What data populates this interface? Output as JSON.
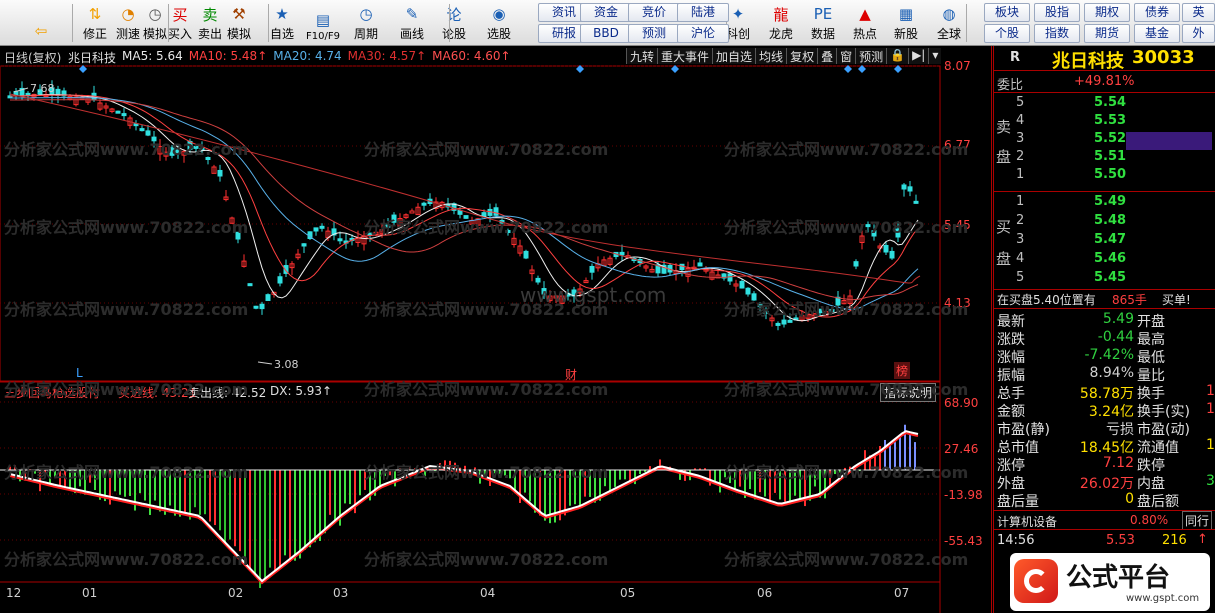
{
  "toolbar": {
    "buttons": [
      {
        "label": "",
        "icon": "back-arrow-icon",
        "color": "#f2a000"
      },
      {
        "label": "修正",
        "icon": "up-down-arrow-icon",
        "color": "#f2a000"
      },
      {
        "label": "测速",
        "icon": "speed-icon",
        "color": "#e08000"
      },
      {
        "label": "模拟",
        "icon": "clock-icon",
        "color": "#555"
      },
      {
        "label": "买入",
        "icon": "buy-icon",
        "color": "#d00"
      },
      {
        "label": "卖出",
        "icon": "sell-icon",
        "color": "#080"
      },
      {
        "label": "模拟",
        "icon": "hammer-icon",
        "color": "#a04000"
      },
      {
        "label": "自选",
        "icon": "star-icon",
        "color": "#1a5fb4"
      },
      {
        "label": "F10/F9",
        "icon": "f10-icon",
        "color": "#1a5fb4"
      },
      {
        "label": "周期",
        "icon": "period-icon",
        "color": "#1a5fb4"
      },
      {
        "label": "画线",
        "icon": "pencil-icon",
        "color": "#1a5fb4"
      },
      {
        "label": "论股",
        "icon": "forum-icon",
        "color": "#1a5fb4"
      },
      {
        "label": "选股",
        "icon": "select-stock-icon",
        "color": "#1a5fb4"
      },
      {
        "label": "科创",
        "icon": "star-market-icon",
        "color": "#1a5fb4"
      },
      {
        "label": "龙虎",
        "icon": "dragon-tiger-icon",
        "color": "#d00"
      },
      {
        "label": "数据",
        "icon": "pe-data-icon",
        "color": "#1a5fb4"
      },
      {
        "label": "热点",
        "icon": "hot-icon",
        "color": "#d00"
      },
      {
        "label": "新股",
        "icon": "ipo-icon",
        "color": "#1a5fb4"
      },
      {
        "label": "全球",
        "icon": "globe-icon",
        "color": "#1a5fb4"
      }
    ],
    "small_buttons": [
      [
        "资讯",
        "研报"
      ],
      [
        "资金",
        "BBD"
      ],
      [
        "竞价",
        "预测"
      ],
      [
        "陆港",
        "沪伦"
      ],
      [
        "板块",
        "个股"
      ],
      [
        "股指",
        "指数"
      ],
      [
        "期权",
        "期货"
      ],
      [
        "债券",
        "基金"
      ],
      [
        "英",
        "外"
      ]
    ]
  },
  "chart": {
    "title": "日线(复权)",
    "stock_name": "兆日科技",
    "ma": [
      {
        "label": "MA5: 5.64",
        "color": "#e8e8e8"
      },
      {
        "label": "MA10: 5.48↑",
        "color": "#ff4040"
      },
      {
        "label": "MA20: 4.74",
        "color": "#58b0e8"
      },
      {
        "label": "MA30: 4.57↑",
        "color": "#e03030"
      },
      {
        "label": "MA60: 4.60↑",
        "color": "#ff5050"
      }
    ],
    "top_buttons": [
      "九转",
      "重大事件",
      "加自选",
      "均线",
      "复权",
      "叠",
      "窗",
      "预测",
      "🔒",
      "▶|",
      "▾"
    ],
    "price_axis": [
      "8.07",
      "6.77",
      "5.45",
      "4.13"
    ],
    "high_label": "7.68",
    "low_label": "3.08",
    "markers": [
      "L",
      "财",
      "榜"
    ],
    "indicator": {
      "name": "三步回马枪选股付",
      "buy_line": "买进线: 43.21",
      "sell_line": "卖出线: 42.52",
      "dx": "DX: 5.93↑",
      "explain_button": "指标说明",
      "axis": [
        "68.90",
        "27.46",
        "-13.98",
        "-55.43"
      ]
    },
    "date_axis": [
      "12",
      "01",
      "02",
      "03",
      "04",
      "05",
      "06",
      "07"
    ],
    "watermark_site": "分析家公式网www.70822.com",
    "watermark_gspt": "www.gspt.com"
  },
  "panel": {
    "header": {
      "label": "R",
      "name": "兆日科技",
      "code": "30033"
    },
    "weibi": {
      "label": "委比",
      "value": "+49.81%"
    },
    "sell_side_label": [
      "卖",
      "盘"
    ],
    "buy_side_label": [
      "买",
      "盘"
    ],
    "sell": [
      {
        "n": "5",
        "price": "5.54"
      },
      {
        "n": "4",
        "price": "5.53"
      },
      {
        "n": "3",
        "price": "5.52"
      },
      {
        "n": "2",
        "price": "5.51"
      },
      {
        "n": "1",
        "price": "5.50"
      }
    ],
    "buy": [
      {
        "n": "1",
        "price": "5.49"
      },
      {
        "n": "2",
        "price": "5.48"
      },
      {
        "n": "3",
        "price": "5.47"
      },
      {
        "n": "4",
        "price": "5.46"
      },
      {
        "n": "5",
        "price": "5.45"
      }
    ],
    "position_note": "在买盘5.40位置有",
    "position_qty": "865手",
    "position_tag": "买单!",
    "stats": [
      {
        "l": "最新",
        "v": "5.49",
        "vc": "#30d040",
        "r": "开盘"
      },
      {
        "l": "涨跌",
        "v": "-0.44",
        "vc": "#30d040",
        "r": "最高"
      },
      {
        "l": "涨幅",
        "v": "-7.42%",
        "vc": "#30d040",
        "r": "最低"
      },
      {
        "l": "振幅",
        "v": "8.94%",
        "vc": "#d0d0d0",
        "r": "量比"
      },
      {
        "l": "总手",
        "v": "58.78万",
        "vc": "#ffe000",
        "r": "换手"
      },
      {
        "l": "金额",
        "v": "3.24亿",
        "vc": "#ffe000",
        "r": "换手(实)"
      },
      {
        "l": "市盈(静)",
        "v": "亏损",
        "vc": "#d0d0d0",
        "r": "市盈(动)"
      },
      {
        "l": "总市值",
        "v": "18.45亿",
        "vc": "#ffe000",
        "r": "流通值"
      },
      {
        "l": "涨停",
        "v": "7.12",
        "vc": "#ff4040",
        "r": "跌停"
      },
      {
        "l": "外盘",
        "v": "26.02万",
        "vc": "#ff4040",
        "r": "内盘"
      },
      {
        "l": "盘后量",
        "v": "0",
        "vc": "#ffe000",
        "r": "盘后额"
      }
    ],
    "right_edge": [
      "1",
      "1",
      "1",
      "3"
    ],
    "sector": {
      "name": "计算机设备",
      "pct": "0.80%",
      "tab": "同行"
    },
    "tick": {
      "time": "14:56",
      "price": "5.53",
      "vol": "216"
    },
    "logo": {
      "text": "公式平台",
      "url": "www.gspt.com"
    }
  }
}
